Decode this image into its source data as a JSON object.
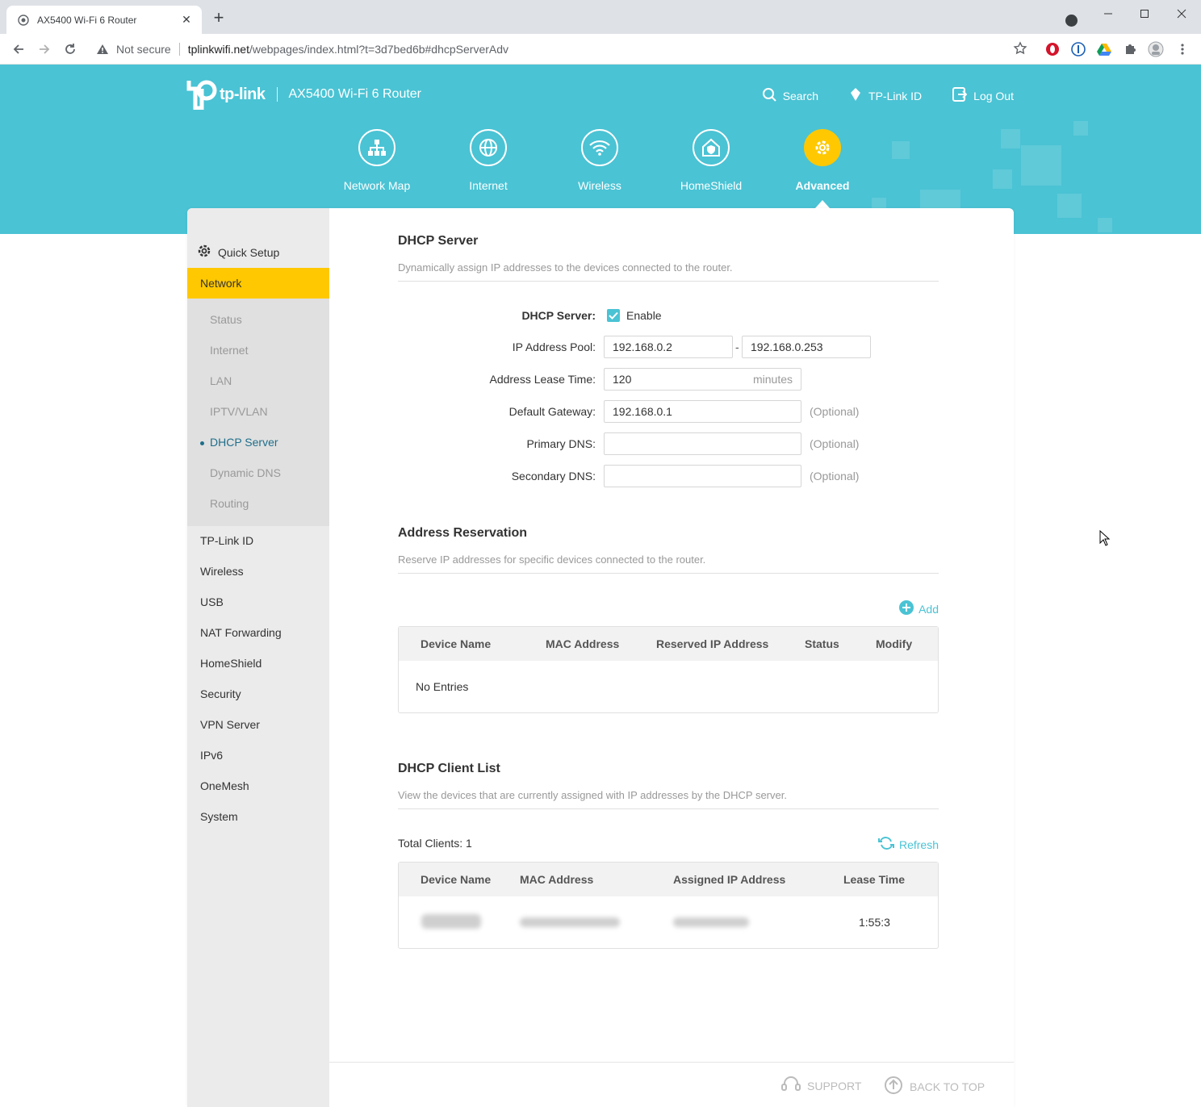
{
  "browser": {
    "tab_title": "AX5400 Wi-Fi 6 Router",
    "new_tab": "+",
    "security_label": "Not secure",
    "url_host": "tplinkwifi.net",
    "url_path": "/webpages/index.html?t=3d7bed6b#dhcpServerAdv"
  },
  "header": {
    "brand": "tp-link",
    "model": "AX5400 Wi-Fi 6 Router",
    "links": {
      "search": "Search",
      "tplink_id": "TP-Link ID",
      "logout": "Log Out"
    },
    "nav": [
      {
        "label": "Network Map",
        "icon": "network-map-icon"
      },
      {
        "label": "Internet",
        "icon": "globe-icon"
      },
      {
        "label": "Wireless",
        "icon": "wifi-icon"
      },
      {
        "label": "HomeShield",
        "icon": "home-shield-icon"
      },
      {
        "label": "Advanced",
        "icon": "gear-icon",
        "active": true
      }
    ]
  },
  "sidebar": {
    "quick_setup": "Quick Setup",
    "network": "Network",
    "network_sub": [
      "Status",
      "Internet",
      "LAN",
      "IPTV/VLAN",
      "DHCP Server",
      "Dynamic DNS",
      "Routing"
    ],
    "items": [
      "TP-Link ID",
      "Wireless",
      "USB",
      "NAT Forwarding",
      "HomeShield",
      "Security",
      "VPN Server",
      "IPv6",
      "OneMesh",
      "System"
    ]
  },
  "dhcp_server": {
    "title": "DHCP Server",
    "description": "Dynamically assign IP addresses to the devices connected to the router.",
    "server_label": "DHCP Server:",
    "enable_label": "Enable",
    "pool_label": "IP Address Pool:",
    "pool_start": "192.168.0.2",
    "pool_dash": "-",
    "pool_end": "192.168.0.253",
    "lease_label": "Address Lease Time:",
    "lease_value": "120",
    "lease_unit": "minutes",
    "gateway_label": "Default Gateway:",
    "gateway_value": "192.168.0.1",
    "primary_dns_label": "Primary DNS:",
    "secondary_dns_label": "Secondary DNS:",
    "optional": "(Optional)"
  },
  "reservation": {
    "title": "Address Reservation",
    "description": "Reserve IP addresses for specific devices connected to the router.",
    "add_label": "Add",
    "columns": [
      "Device Name",
      "MAC Address",
      "Reserved IP Address",
      "Status",
      "Modify"
    ],
    "empty": "No Entries"
  },
  "client_list": {
    "title": "DHCP Client List",
    "description": "View the devices that are currently assigned with IP addresses by the DHCP server.",
    "total_label": "Total Clients: 1",
    "refresh_label": "Refresh",
    "columns": [
      "Device Name",
      "MAC Address",
      "Assigned IP Address",
      "Lease Time"
    ],
    "rows": [
      {
        "lease_time": "1:55:3"
      }
    ]
  },
  "footer": {
    "support": "SUPPORT",
    "back_to_top": "BACK TO TOP"
  },
  "colors": {
    "accent": "#4ac3d4",
    "active": "#ffc800",
    "active_text": "#1e6e8a"
  }
}
